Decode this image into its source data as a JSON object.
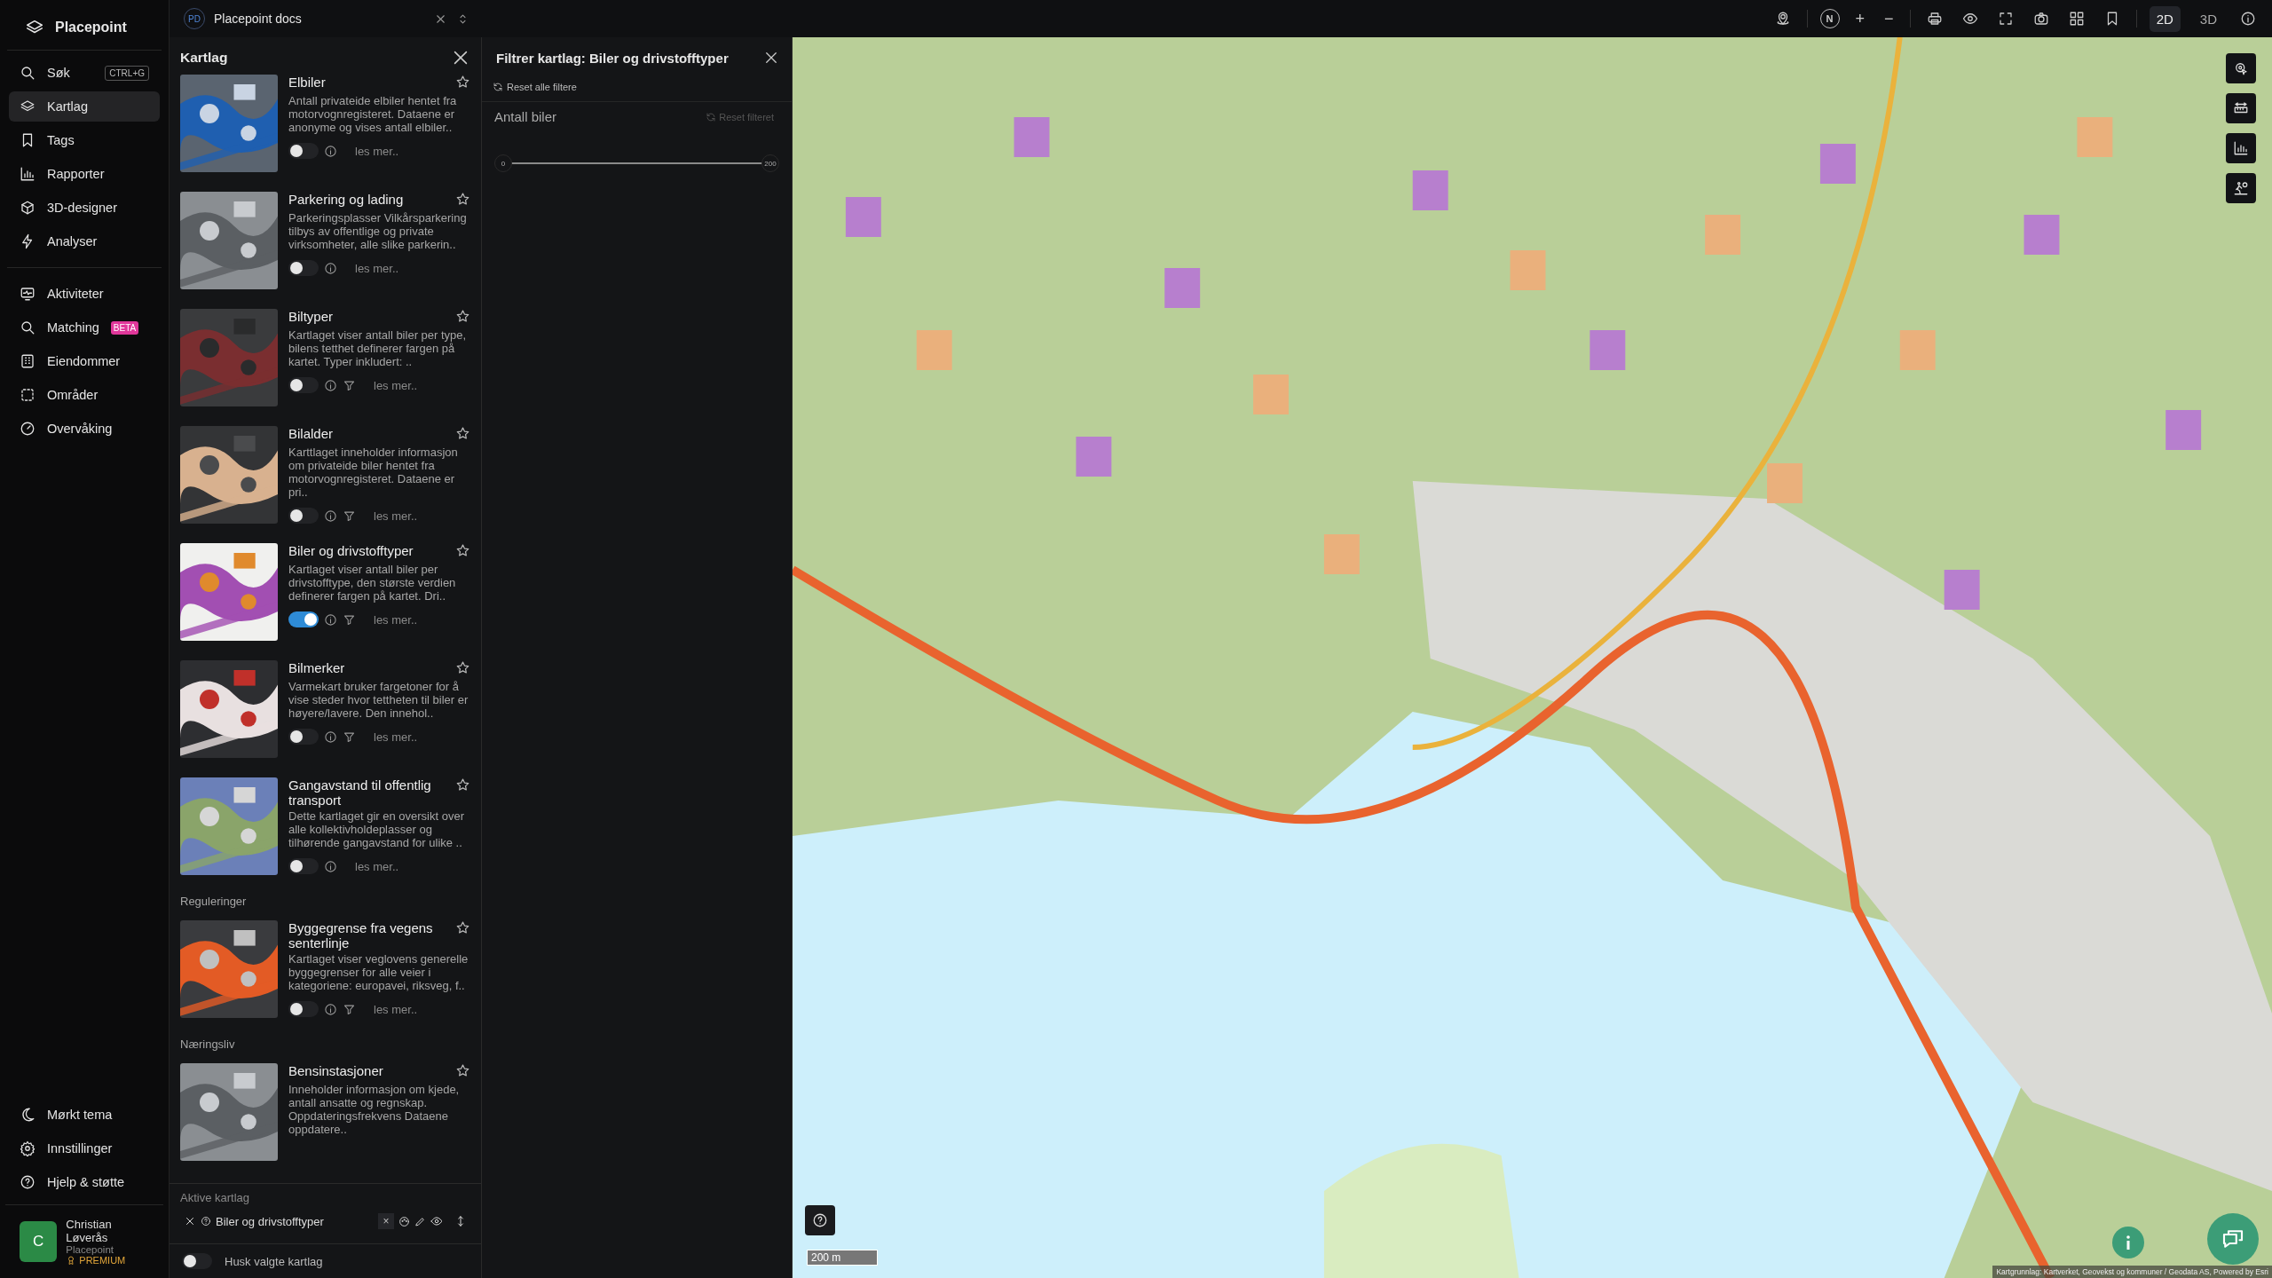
{
  "app": {
    "name": "Placepoint"
  },
  "nav": [
    {
      "label": "Søk",
      "shortcut": "CTRL+G",
      "selected": false
    },
    {
      "label": "Kartlag",
      "selected": true
    },
    {
      "label": "Tags",
      "selected": false
    },
    {
      "label": "Rapporter",
      "selected": false
    },
    {
      "label": "3D-designer",
      "selected": false
    },
    {
      "label": "Analyser",
      "selected": false
    }
  ],
  "nav2": [
    {
      "label": "Aktiviteter",
      "selected": false
    },
    {
      "label": "Matching",
      "badge": "BETA",
      "selected": false
    },
    {
      "label": "Eiendommer",
      "selected": false
    },
    {
      "label": "Områder",
      "selected": false
    },
    {
      "label": "Overvåking",
      "selected": false
    }
  ],
  "bottom_nav": [
    {
      "label": "Mørkt tema"
    },
    {
      "label": "Innstillinger"
    },
    {
      "label": "Hjelp & støtte"
    }
  ],
  "user": {
    "initial": "C",
    "name": "Christian Løverås",
    "org": "Placepoint",
    "plan": "PREMIUM"
  },
  "workspace": {
    "initials": "PD",
    "name": "Placepoint docs"
  },
  "layers_panel": {
    "title": "Kartlag",
    "items": [
      {
        "kind": "layer",
        "title": "Elbiler",
        "description": "Antall privateide elbiler hentet fra motorvognregisteret. Dataene er anonyme og vises antall elbiler..",
        "on": false,
        "filter": false,
        "more": "les mer.."
      },
      {
        "kind": "layer",
        "title": "Parkering og lading",
        "description": "Parkeringsplasser Vilkårsparkering tilbys av offentlige og private virksomheter, alle slike parkerin..",
        "on": false,
        "filter": false,
        "more": "les mer.."
      },
      {
        "kind": "layer",
        "title": "Biltyper",
        "description": "Kartlaget viser antall biler per type, bilens tetthet definerer fargen på kartet. Typer inkludert: ..",
        "on": false,
        "filter": true,
        "more": "les mer.."
      },
      {
        "kind": "layer",
        "title": "Bilalder",
        "description": "Karttlaget inneholder informasjon om privateide biler hentet fra motorvognregisteret. Dataene er pri..",
        "on": false,
        "filter": true,
        "more": "les mer.."
      },
      {
        "kind": "layer",
        "title": "Biler og drivstofftyper",
        "description": "Kartlaget viser antall biler per drivstofftype, den største verdien definerer fargen på kartet. Dri..",
        "on": true,
        "filter": true,
        "more": "les mer.."
      },
      {
        "kind": "layer",
        "title": "Bilmerker",
        "description": "Varmekart bruker fargetoner for å vise steder hvor tettheten til biler er høyere/lavere. Den innehol..",
        "on": false,
        "filter": true,
        "more": "les mer.."
      },
      {
        "kind": "layer",
        "title": "Gangavstand til offentlig transport",
        "description": "Dette kartlaget gir en oversikt over alle kollektivholdeplasser og tilhørende gangavstand for ulike ..",
        "on": false,
        "filter": false,
        "more": "les mer.."
      },
      {
        "kind": "section",
        "title": "Reguleringer"
      },
      {
        "kind": "layer",
        "title": "Byggegrense fra vegens senterlinje",
        "description": "Kartlaget viser veglovens generelle byggegrenser for alle veier i kategoriene: europavei, riksveg, f..",
        "on": false,
        "filter": true,
        "more": "les mer.."
      },
      {
        "kind": "section",
        "title": "Næringsliv"
      },
      {
        "kind": "layer",
        "title": "Bensinstasjoner",
        "description": "Inneholder informasjon om kjede, antall ansatte og regnskap. Oppdateringsfrekvens Dataene oppdatere.."
      }
    ]
  },
  "active_layers": {
    "title": "Aktive kartlag",
    "items": [
      {
        "name": "Biler og drivstofftyper",
        "clear": "×"
      }
    ],
    "remember": {
      "label": "Husk valgte kartlag",
      "on": false
    }
  },
  "filter_panel": {
    "title": "Filtrer kartlag: Biler og drivstofftyper",
    "reset_all": "Reset alle filtere",
    "filters": [
      {
        "name": "Antall biler",
        "reset": "Reset filteret",
        "min": "0",
        "max": "200",
        "level": 1
      }
    ]
  },
  "toolbar": {
    "compass": "N",
    "zoom_in": "+",
    "zoom_out": "−",
    "modes": [
      {
        "label": "2D",
        "selected": true
      },
      {
        "label": "3D",
        "selected": false
      }
    ]
  },
  "map": {
    "kind": "picture",
    "scale": "200 m",
    "attribution": "Kartgrunnlag: Kartverket, Geovekst og kommuner / Geodata AS, Powered by Esri"
  }
}
